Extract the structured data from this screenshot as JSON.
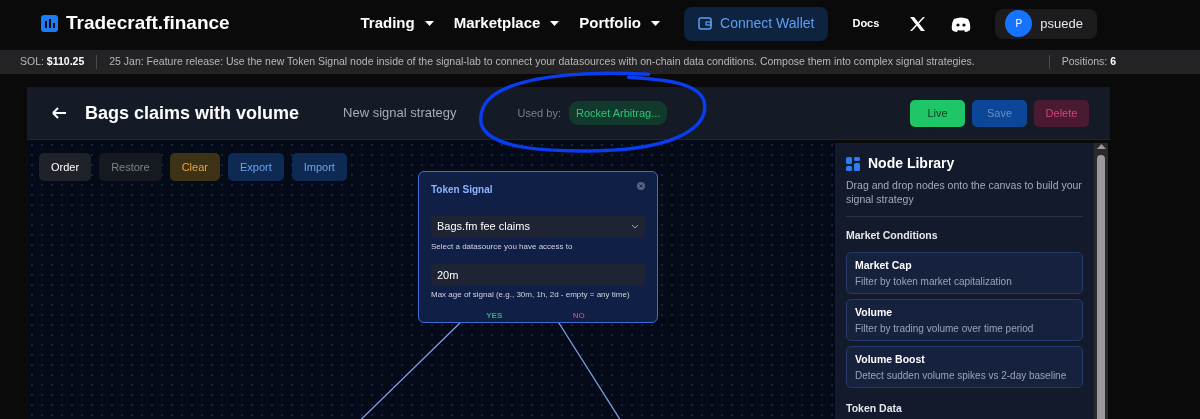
{
  "brand": {
    "name": "Tradecraft.finance"
  },
  "nav": [
    {
      "label": "Trading",
      "dropdown": true
    },
    {
      "label": "Marketplace",
      "dropdown": true
    },
    {
      "label": "Portfolio",
      "dropdown": true
    }
  ],
  "connect_wallet": "Connect Wallet",
  "docs": "Docs",
  "user": {
    "initial": "P",
    "name": "psuede"
  },
  "ticker": {
    "sol_label": "SOL:",
    "sol_value": "$110.25",
    "message": "25 Jan: Feature release: Use the new Token Signal node inside of the signal-lab to connect your datasources with on-chain data conditions. Compose them into complex signal strategies.",
    "positions_label": "Positions:",
    "positions_value": "6"
  },
  "strategy": {
    "title": "Bags claims with volume",
    "subtitle": "New signal strategy",
    "used_by_label": "Used by:",
    "used_by": "Rocket Arbitrag..."
  },
  "annotation": {
    "kind": "circle"
  },
  "actions": [
    {
      "label": "Live",
      "kind": "success"
    },
    {
      "label": "Save",
      "kind": "primary"
    },
    {
      "label": "Delete",
      "kind": "danger"
    }
  ],
  "toolbar": [
    {
      "label": "Order",
      "kind": "neutral"
    },
    {
      "label": "Restore",
      "kind": "muted"
    },
    {
      "label": "Clear",
      "kind": "warning"
    },
    {
      "label": "Export",
      "kind": "info"
    },
    {
      "label": "Import",
      "kind": "info"
    }
  ],
  "node": {
    "title": "Token Signal",
    "datasource": "Bags.fm fee claims",
    "datasource_help": "Select a datasource you have access to",
    "max_age": "20m",
    "max_age_help": "Max age of signal (e.g., 30m, 1h, 2d - empty = any time)",
    "outputs": [
      {
        "label": "YES",
        "kind": "yes"
      },
      {
        "label": "NO",
        "kind": "no"
      }
    ]
  },
  "library": {
    "title": "Node Library",
    "description": "Drag and drop nodes onto the canvas to build your signal strategy",
    "groups": [
      {
        "title": "Market Conditions",
        "items": [
          {
            "name": "Market Cap",
            "description": "Filter by token market capitalization"
          },
          {
            "name": "Volume",
            "description": "Filter by trading volume over time period"
          },
          {
            "name": "Volume Boost",
            "description": "Detect sudden volume spikes vs 2-day baseline"
          }
        ]
      },
      {
        "title": "Token Data"
      }
    ]
  }
}
